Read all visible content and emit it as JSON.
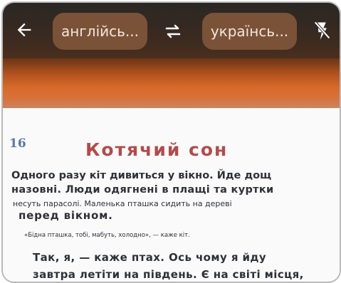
{
  "toolbar": {
    "back_icon": "arrow-left-icon",
    "source_language": "англійсь...",
    "swap_icon": "swap-arrows-icon",
    "target_language": "українсь...",
    "flash_icon": "flash-off-icon"
  },
  "page": {
    "number": "16",
    "title": "Котячий сон",
    "lines": [
      "Одного разу кіт дивиться у вікно. Йде дощ",
      "назовні. Люди одягнені в плащі та куртки",
      "несуть парасолі. Маленька пташка сидить на дереві",
      "перед вікном.",
      "«Бідна пташка, тобі, мабуть, холодно», — каже кіт.",
      "Так, я, — каже птах. Ось чому я йду",
      "завтра летіти на південь. Є на світі місця,"
    ]
  },
  "colors": {
    "pill_bg": "#7a5238",
    "title_red": "#b54a4a",
    "number_blue": "#5a77a8"
  }
}
